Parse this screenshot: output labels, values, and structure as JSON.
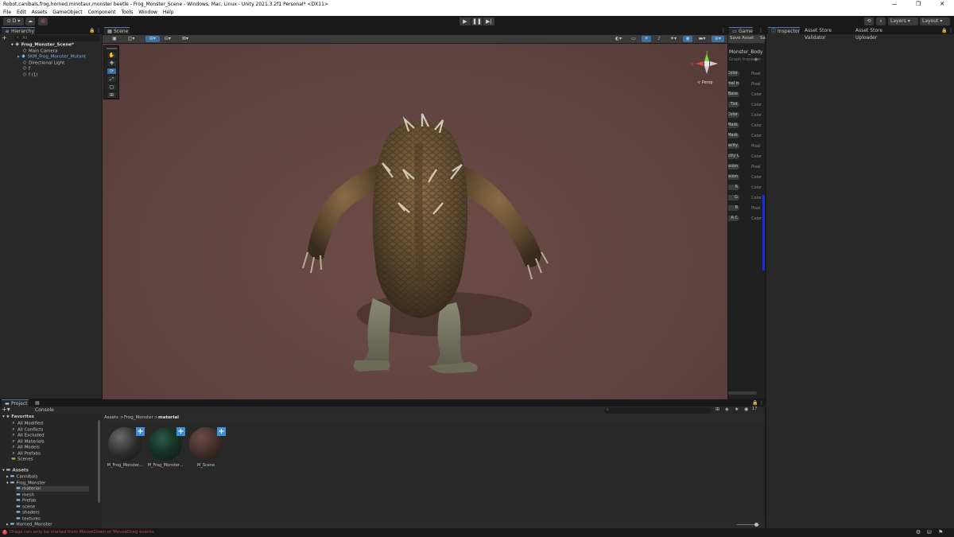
{
  "window": {
    "title": "Robot,canibals,frog,horned,minotaur,monster beetle - Frog_Monster_Scene - Windows, Mac, Linux - Unity 2021.3.2f1 Personal* <DX11>",
    "buttons": [
      "—",
      "❐",
      "✕"
    ]
  },
  "menu": [
    "File",
    "Edit",
    "Assets",
    "GameObject",
    "Component",
    "Tools",
    "Window",
    "Help"
  ],
  "toolbar": {
    "account": "D",
    "layers": "Layers",
    "layout": "Layout"
  },
  "hierarchy": {
    "tab": "Hierarchy",
    "search_placeholder": "All",
    "items": [
      {
        "label": "Frog_Monster_Scene*",
        "depth": 0,
        "color": "#e0e0e0",
        "bold": true
      },
      {
        "label": "Main Camera",
        "depth": 1,
        "color": "#c8c8c8"
      },
      {
        "label": "SKM_Frog_Monster_Mutant",
        "depth": 1,
        "color": "#7fb0e6"
      },
      {
        "label": "Directional Light",
        "depth": 1,
        "color": "#c8c8c8"
      },
      {
        "label": "f",
        "depth": 1,
        "color": "#c8c8c8"
      },
      {
        "label": "f (1)",
        "depth": 1,
        "color": "#c8c8c8"
      }
    ]
  },
  "scene": {
    "tab": "Scene",
    "persp_label": "< Persp",
    "gizmo_axes": {
      "y": "y",
      "x": "x"
    }
  },
  "game": {
    "tab": "Game",
    "save_asset": "Save Asset",
    "sa": "Sa",
    "node_title": "Monster_Body",
    "graph_inspector": "Graph Inspector",
    "properties": [
      {
        "name": "Color",
        "type": "Pixel"
      },
      {
        "name": "Normal map",
        "type": "Pixel"
      },
      {
        "name": "Base",
        "type": "Color"
      },
      {
        "name": "Tint",
        "type": "Color"
      },
      {
        "name": "Color",
        "type": "Color"
      },
      {
        "name": "Mask",
        "type": "Color"
      },
      {
        "name": "Mask",
        "type": "Color"
      },
      {
        "name": "Opacity",
        "type": "Pixel"
      },
      {
        "name": "Opacity C",
        "type": "Color"
      },
      {
        "name": "Emission",
        "type": "Pixel"
      },
      {
        "name": "Emission C",
        "type": "Color"
      },
      {
        "name": "R",
        "type": "Color"
      },
      {
        "name": "G",
        "type": "Color"
      },
      {
        "name": "B",
        "type": "Pixel"
      },
      {
        "name": "A C",
        "type": "Color"
      }
    ]
  },
  "inspector": {
    "tabs": [
      "Inspector",
      "Asset Store Validator",
      "Asset Store Uploader"
    ]
  },
  "project": {
    "tabs": [
      "Project",
      "Console"
    ],
    "breadcrumb": [
      "Assets",
      "Frog_Monster",
      "material"
    ],
    "favorites_label": "Favorites",
    "favorites": [
      "All Modified",
      "All Conflicts",
      "All Excluded",
      "All Materials",
      "All Models",
      "All Prefabs",
      "Scenes"
    ],
    "assets_label": "Assets",
    "tree": [
      {
        "label": "Cannibals",
        "depth": 1
      },
      {
        "label": "Frog_Monster",
        "depth": 1
      },
      {
        "label": "material",
        "depth": 2,
        "selected": true
      },
      {
        "label": "mesh",
        "depth": 2
      },
      {
        "label": "Prefab",
        "depth": 2
      },
      {
        "label": "scene",
        "depth": 2
      },
      {
        "label": "shaders",
        "depth": 2
      },
      {
        "label": "textures",
        "depth": 2
      },
      {
        "label": "Horned_Monster",
        "depth": 1
      }
    ],
    "assets": [
      {
        "label": "M_Frog_Monster...",
        "style": "dark-sphere"
      },
      {
        "label": "M_Frog_Monster...",
        "style": "green-sphere"
      },
      {
        "label": "M_Scene",
        "style": "brown-sphere"
      }
    ],
    "asset_count": "17",
    "search_placeholder": ""
  },
  "status": {
    "message": "Drags can only be started from MouseDown or MouseDrag events"
  },
  "colors": {
    "accent": "#3a79bb",
    "error": "#e04040",
    "asset_plus": "#3f8fd6"
  }
}
